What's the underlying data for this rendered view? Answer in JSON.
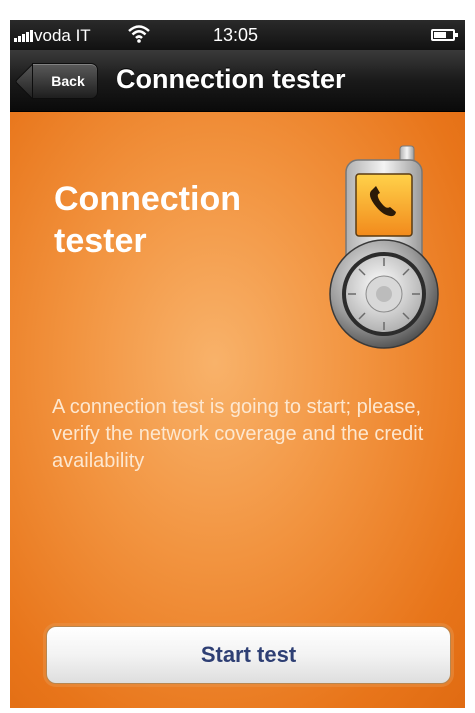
{
  "status_bar": {
    "carrier": "voda IT",
    "time": "13:05",
    "signal_icon": "signal-bars-icon",
    "wifi_icon": "wifi-icon",
    "battery_icon": "battery-icon"
  },
  "nav_bar": {
    "back_label": "Back",
    "title": "Connection tester"
  },
  "content": {
    "heading": "Connection tester",
    "illustration_icon": "phone-lock-icon",
    "message": "A connection test is going to start; please, verify the network coverage and the credit availability",
    "start_button_label": "Start test"
  },
  "colors": {
    "background_orange": "#f29440",
    "nav_black": "#111111",
    "button_text": "#2e3f74"
  }
}
